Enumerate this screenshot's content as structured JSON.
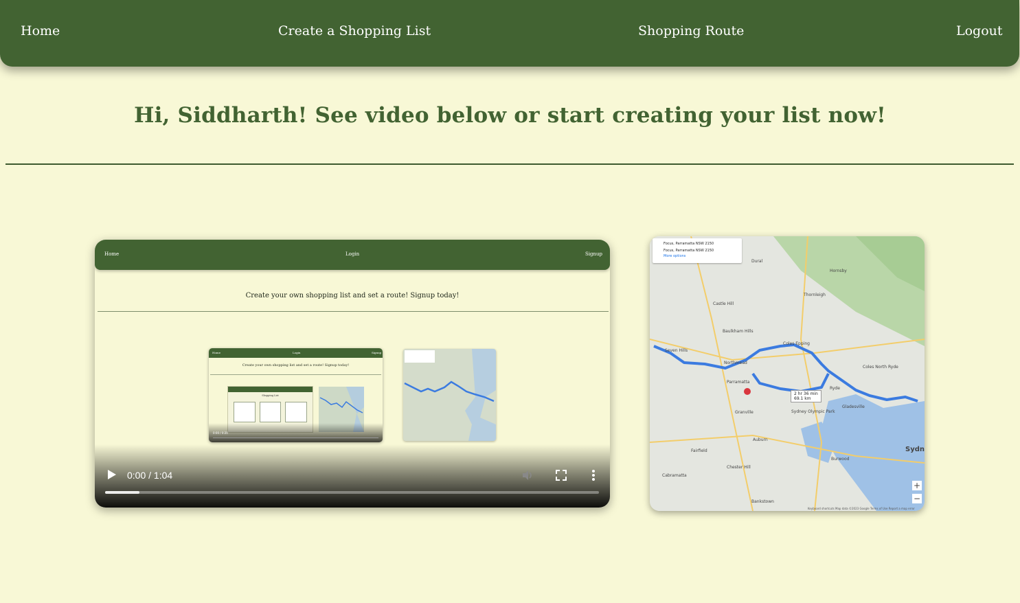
{
  "nav": {
    "home": "Home",
    "create_list": "Create a Shopping List",
    "route": "Shopping Route",
    "logout": "Logout"
  },
  "heading": "Hi, Siddharth! See video below or start creating your list now!",
  "video": {
    "time": "0:00 / 1:04",
    "progress": 0.07,
    "frame": {
      "nav": {
        "home": "Home",
        "login": "Login",
        "signup": "Signup"
      },
      "heading": "Create your own shopping list and set a route! Signup today!",
      "inner": {
        "nav": {
          "home": "Home",
          "login": "Login",
          "signup": "Signup"
        },
        "heading": "Create your own shopping list and set a route! Signup today!",
        "card_title": "Shopping List",
        "time": "0:00 / 0:20"
      }
    }
  },
  "map": {
    "origin": "Focus, Parramatta NSW 2150",
    "destination": "Focus, Parramatta NSW 2150",
    "more_options": "More options",
    "duration": "2 hr 36 min",
    "distance": "69.1 km",
    "labels": [
      "Dural",
      "Hornsby",
      "Castle Hill",
      "Thornleigh",
      "Baulkham Hills",
      "Coles Epping",
      "Seven Hills",
      "Northmead",
      "Coles North Ryde",
      "Ryde",
      "Parramatta",
      "Gladesville",
      "Granville",
      "Auburn",
      "Burwood",
      "Fairfield",
      "Bankstown",
      "Chester Hill",
      "Cabramatta",
      "Sydney Olympic Park",
      "Sydney"
    ],
    "footer": "Keyboard shortcuts   Map data ©2023 Google   Terms of Use   Report a map error",
    "zoom_in": "+",
    "zoom_out": "−"
  },
  "colors": {
    "background": "#f8f8d6",
    "accent": "#426332",
    "route": "#3b7be0"
  }
}
